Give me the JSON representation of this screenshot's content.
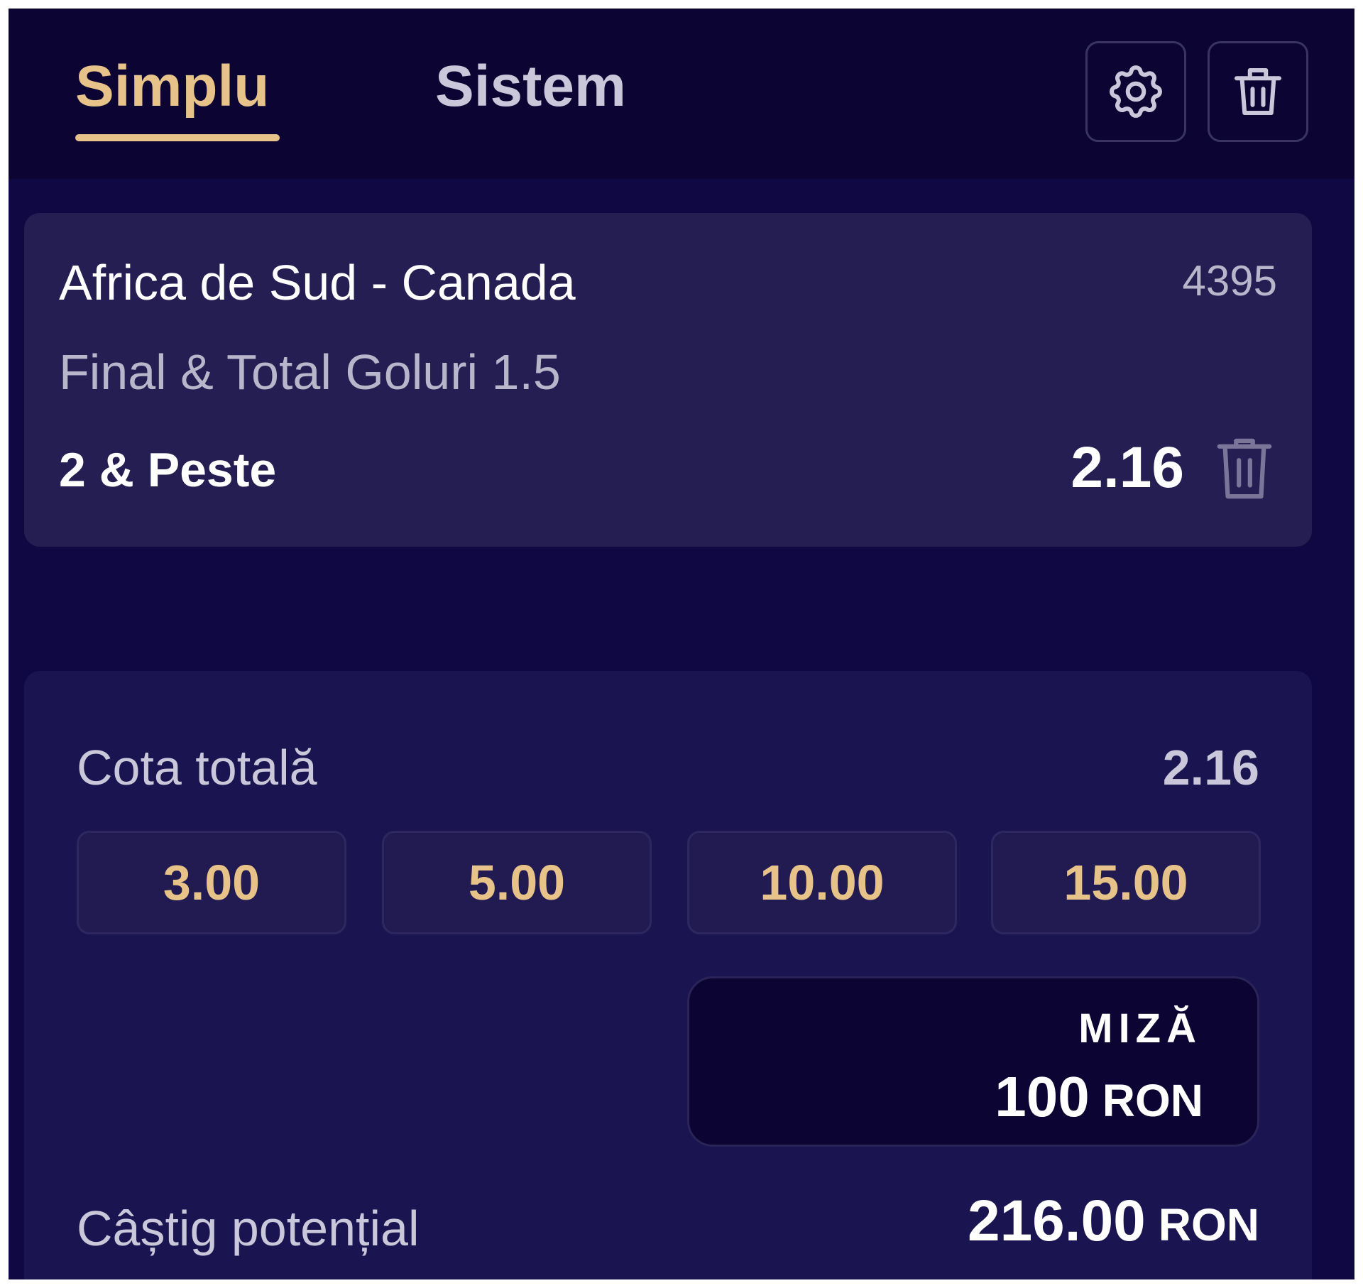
{
  "tabs": {
    "simplu": "Simplu",
    "sistem": "Sistem",
    "active": "Simplu"
  },
  "header_icons": {
    "settings": "gear-icon",
    "clear": "trash-icon"
  },
  "selection": {
    "event": "Africa de Sud - Canada",
    "code": "4395",
    "market": "Final & Total Goluri 1.5",
    "pick": "2 & Peste",
    "odds": "2.16"
  },
  "summary": {
    "total_odds_label": "Cota totală",
    "total_odds_value": "2.16",
    "quick_stakes": [
      "3.00",
      "5.00",
      "10.00",
      "15.00"
    ],
    "stake_label": "MIZĂ",
    "stake_amount": "100",
    "stake_currency": "RON",
    "win_label": "Câștig potențial",
    "win_amount": "216.00",
    "win_currency": "RON"
  },
  "colors": {
    "background": "#0c0533",
    "card": "#251e52",
    "summary_card": "#1a1450",
    "accent_gold": "#e7c38a",
    "text_muted": "#b9b6cc"
  }
}
